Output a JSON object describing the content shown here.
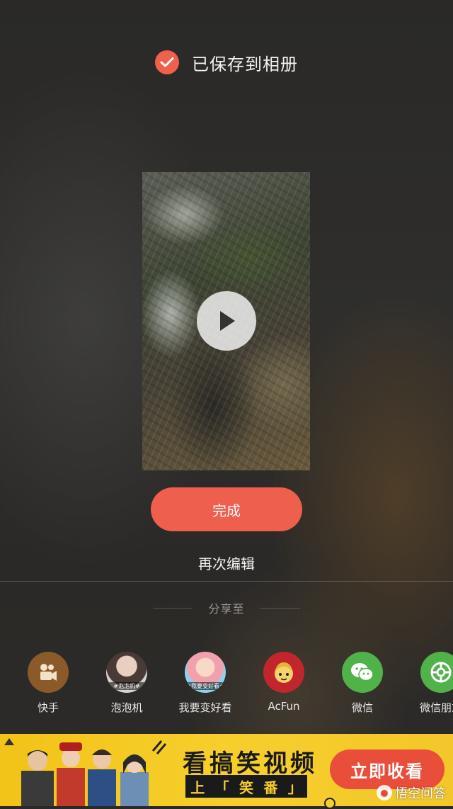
{
  "status": {
    "saved_text": "已保存到相册",
    "icon": "check-icon",
    "accent_color": "#f0604d"
  },
  "preview": {
    "play_icon": "play-icon"
  },
  "actions": {
    "done_label": "完成",
    "edit_again_label": "再次编辑"
  },
  "share": {
    "title": "分享至",
    "targets": [
      {
        "label": "快手",
        "icon": "kuaishou-icon",
        "color": "#8a5a2b"
      },
      {
        "label": "泡泡机",
        "icon": "paopaoji-avatar",
        "tag": "#泡泡机#"
      },
      {
        "label": "我要变好看",
        "icon": "bianhaokan-avatar",
        "tag": "#我要变好看#"
      },
      {
        "label": "AcFun",
        "icon": "acfun-icon",
        "color": "#c0262c"
      },
      {
        "label": "微信",
        "icon": "wechat-icon",
        "color": "#4fb34a"
      },
      {
        "label": "微信朋友",
        "icon": "wechat-moments-icon",
        "color": "#4fb34a"
      }
    ]
  },
  "ad": {
    "headline": "看搞笑视频",
    "sub_chars": [
      "上",
      "「",
      "笑",
      "番",
      "」"
    ],
    "cta_label": "立即收看",
    "watermark": "悟空问答"
  }
}
